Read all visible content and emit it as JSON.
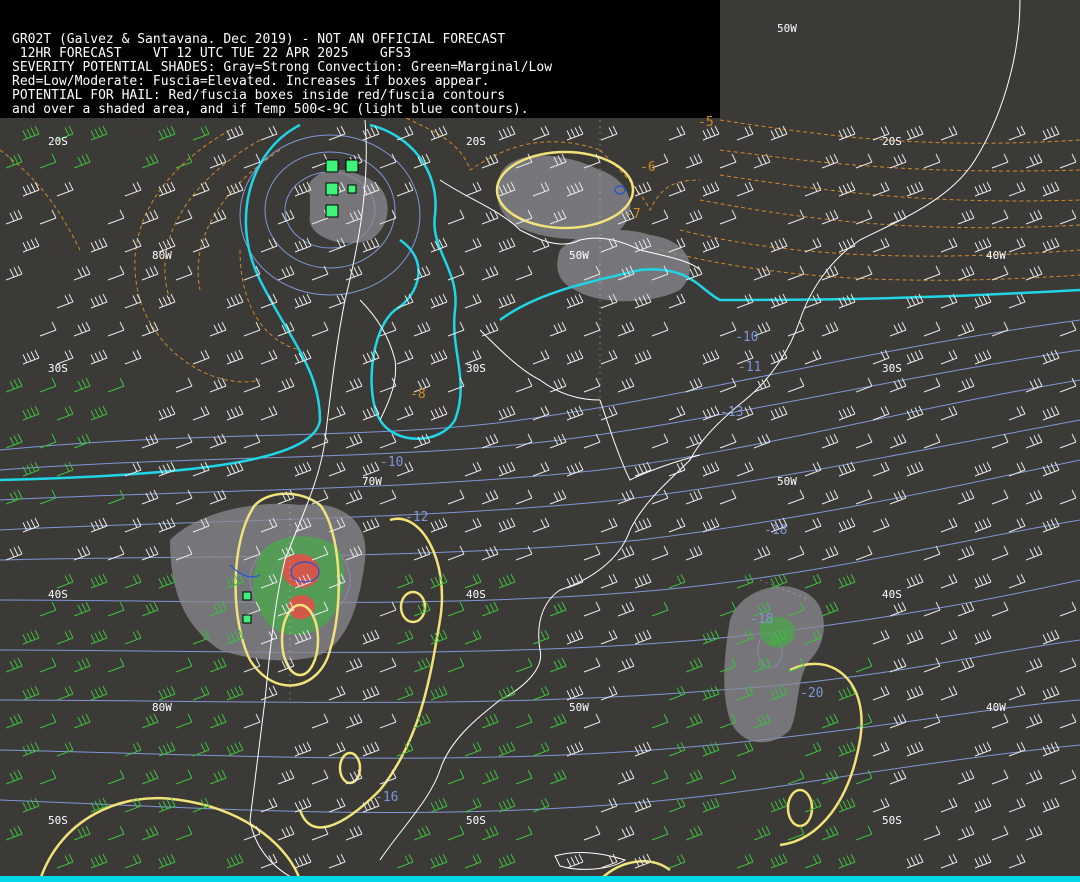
{
  "header": {
    "lines": [
      "GR02T (Galvez & Santavana. Dec 2019) - NOT AN OFFICIAL FORECAST",
      " 12HR FORECAST    VT 12 UTC TUE 22 APR 2025    GFS3",
      "SEVERITY POTENTIAL SHADES: Gray=Strong Convection: Green=Marginal/Low",
      "Red=Low/Moderate: Fuscia=Elevated. Increases if boxes appear.",
      "POTENTIAL FOR HAIL: Red/fuscia boxes inside red/fuscia contours",
      "and over a shaded area, and if Temp 500<-9C (light blue contours)."
    ]
  },
  "grid_labels": {
    "lon_50w_top": "50W",
    "lat_20s_left": "20S",
    "lat_20s_mid": "20S",
    "lat_20s_right": "20S",
    "lon_80w_upper": "80W",
    "lon_50w_upper": "50W",
    "lon_40w_upper": "40W",
    "lat_30s_left": "30S",
    "lat_30s_mid": "30S",
    "lat_30s_right": "30S",
    "lon_70w_mid": "70W",
    "lon_50w_mid": "50W",
    "lat_40s_left": "40S",
    "lat_40s_mid": "40S",
    "lat_40s_right": "40S",
    "lon_80w_lower": "80W",
    "lon_50w_lower": "50W",
    "lon_40w_lower": "40W",
    "lat_50s_left": "50S",
    "lat_50s_mid": "50S",
    "lat_50s_right": "50S"
  },
  "contour_labels": {
    "temp_minus5": "-5",
    "temp_minus6": "-6",
    "temp_minus7": "-7",
    "temp_minus8": "-8",
    "blue_minus10_a": "-10",
    "blue_minus10_b": "-10",
    "blue_minus11": "-11",
    "blue_minus12": "-12",
    "blue_minus13": "-13",
    "blue_minus18_a": "-18",
    "blue_minus18_b": "-18",
    "blue_minus20": "-20",
    "blue_minus16": "-16"
  },
  "colors": {
    "background": "#3b3a36",
    "coastline": "#ffffff",
    "cyan_contour": "#1fd6e6",
    "yellow_contour": "#f2e27a",
    "orange_dashed": "#d08a2a",
    "light_blue_contour": "#7f97d8",
    "gray_shade": "#8a8a92",
    "green_shade": "#4fa34f",
    "red_shade": "#d2584a",
    "wind_barb_white": "#e8e8e8",
    "wind_barb_green": "#3fbf3f",
    "box_green": "#3ff27a"
  },
  "legend": {
    "strong_convection_color": "Gray",
    "marginal_low_color": "Green",
    "low_moderate_color": "Red",
    "elevated_color": "Fuscia"
  }
}
